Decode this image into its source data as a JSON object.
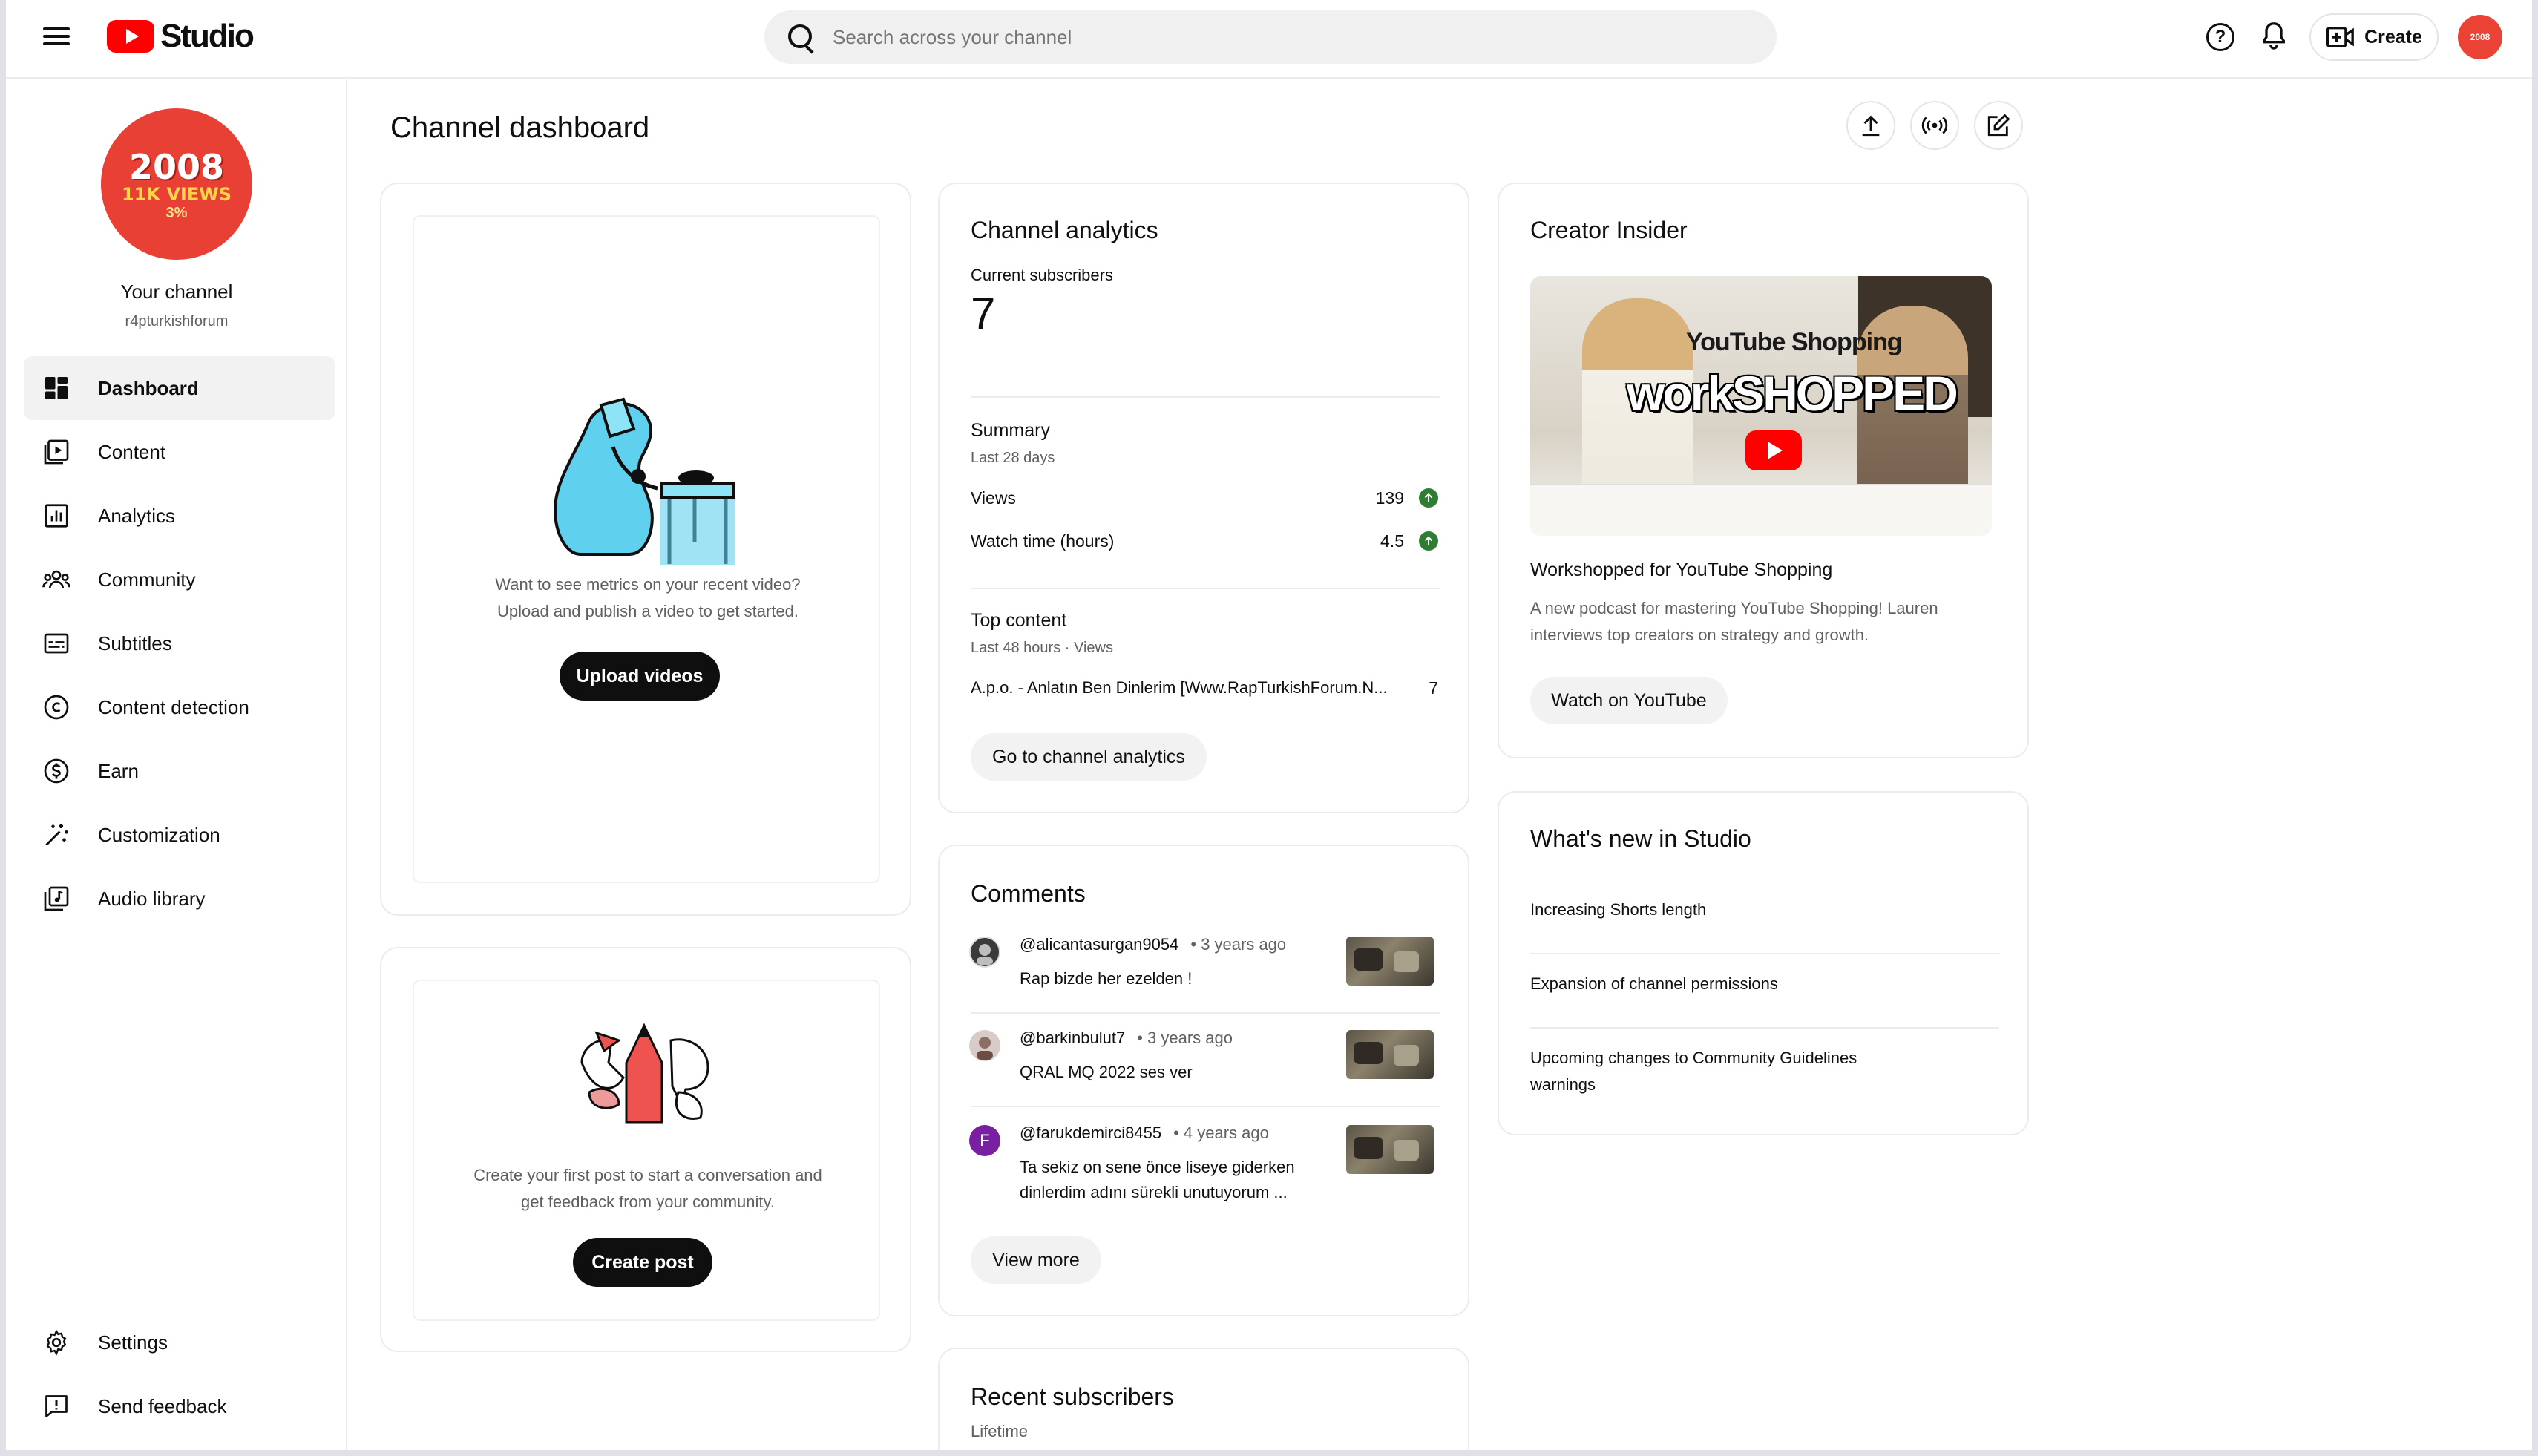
{
  "header": {
    "app_name": "Studio",
    "search_placeholder": "Search across your channel",
    "create_label": "Create",
    "avatar_text": "2008"
  },
  "sidebar": {
    "avatar": {
      "line1": "2008",
      "line2": "11K VIEWS",
      "line3": "3%"
    },
    "channel_title": "Your channel",
    "channel_handle": "r4pturkishforum",
    "items": [
      {
        "label": "Dashboard",
        "icon": "dashboard-icon",
        "active": true
      },
      {
        "label": "Content",
        "icon": "content-icon"
      },
      {
        "label": "Analytics",
        "icon": "analytics-icon"
      },
      {
        "label": "Community",
        "icon": "community-icon"
      },
      {
        "label": "Subtitles",
        "icon": "subtitles-icon"
      },
      {
        "label": "Content detection",
        "icon": "copyright-icon"
      },
      {
        "label": "Earn",
        "icon": "dollar-icon"
      },
      {
        "label": "Customization",
        "icon": "magic-wand-icon"
      },
      {
        "label": "Audio library",
        "icon": "audio-library-icon"
      }
    ],
    "bottom_items": [
      {
        "label": "Settings",
        "icon": "gear-icon"
      },
      {
        "label": "Send feedback",
        "icon": "feedback-icon"
      }
    ]
  },
  "main": {
    "title": "Channel dashboard",
    "upload_card": {
      "text_line1": "Want to see metrics on your recent video?",
      "text_line2": "Upload and publish a video to get started.",
      "button": "Upload videos"
    },
    "post_card": {
      "text_line1": "Create your first post to start a conversation and",
      "text_line2": "get feedback from your community.",
      "button": "Create post"
    },
    "analytics": {
      "title": "Channel analytics",
      "subs_label": "Current subscribers",
      "subs_value": "7",
      "summary_title": "Summary",
      "summary_period": "Last 28 days",
      "rows": [
        {
          "label": "Views",
          "value": "139"
        },
        {
          "label": "Watch time (hours)",
          "value": "4.5"
        }
      ],
      "top_title": "Top content",
      "top_period": "Last 48 hours · Views",
      "top_item": "A.p.o. - Anlatın Ben Dinlerim [Www.RapTurkishForum.N...",
      "top_value": "7",
      "button": "Go to channel analytics"
    },
    "comments": {
      "title": "Comments",
      "items": [
        {
          "user": "@alicantasurgan9054",
          "time": "• 3 years ago",
          "text": "Rap bizde her ezelden !"
        },
        {
          "user": "@barkinbulut7",
          "time": "• 3 years ago",
          "text": "QRAL MQ 2022 ses ver"
        },
        {
          "user": "@farukdemirci8455",
          "time": "• 4 years ago",
          "text": "Ta sekiz on sene önce liseye giderken dinlerdim adını sürekli unutuyorum ...",
          "avatar_letter": "F"
        }
      ],
      "button": "View more"
    },
    "recent_subs": {
      "title": "Recent subscribers",
      "period": "Lifetime"
    },
    "creator_insider": {
      "title": "Creator Insider",
      "thumb_brand": "YouTube Shopping",
      "thumb_text": "workSHOPPED",
      "video_title": "Workshopped for YouTube Shopping",
      "description": "A new podcast for mastering YouTube Shopping! Lauren interviews top creators on strategy and growth.",
      "button": "Watch on YouTube"
    },
    "whats_new": {
      "title": "What's new in Studio",
      "items": [
        "Increasing Shorts length",
        "Expansion of channel permissions",
        "Upcoming changes to Community Guidelines warnings"
      ]
    }
  },
  "colors": {
    "brand_red": "#ff0000",
    "avatar_red": "#e94036",
    "positive_green": "#2e7d32",
    "purple_avatar": "#7b1fa2"
  }
}
